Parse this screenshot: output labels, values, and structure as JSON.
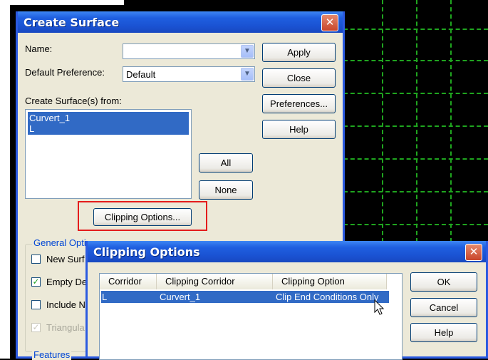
{
  "create_surface": {
    "title": "Create Surface",
    "name_label": "Name:",
    "name_value": "",
    "pref_label": "Default Preference:",
    "pref_value": "Default",
    "from_label": "Create Surface(s) from:",
    "from_items": [
      "Curvert_1",
      "L"
    ],
    "buttons": {
      "apply": "Apply",
      "close": "Close",
      "preferences": "Preferences...",
      "help": "Help",
      "all": "All",
      "none": "None",
      "clipping": "Clipping Options..."
    },
    "general_label": "General Opti",
    "options": [
      {
        "label": "New Surf",
        "checked": false,
        "enabled": true
      },
      {
        "label": "Empty De",
        "checked": true,
        "enabled": true
      },
      {
        "label": "Include N",
        "checked": false,
        "enabled": true
      },
      {
        "label": "Triangula",
        "checked": true,
        "enabled": false
      }
    ],
    "features_label": "Features"
  },
  "clipping_options": {
    "title": "Clipping Options",
    "columns": [
      "Corridor",
      "Clipping Corridor",
      "Clipping Option"
    ],
    "rows": [
      {
        "corridor": "L",
        "clipping_corridor": "Curvert_1",
        "clipping_option": "Clip End Conditions Only"
      }
    ],
    "buttons": {
      "ok": "OK",
      "cancel": "Cancel",
      "help": "Help"
    }
  },
  "icons": {
    "close": "✕",
    "dropdown": "▼",
    "check": "✓"
  },
  "colors": {
    "title_blue": "#1f5fe0",
    "selection": "#316ac5",
    "highlight_red": "#e41c1c",
    "grid_green": "#1fa51f"
  }
}
